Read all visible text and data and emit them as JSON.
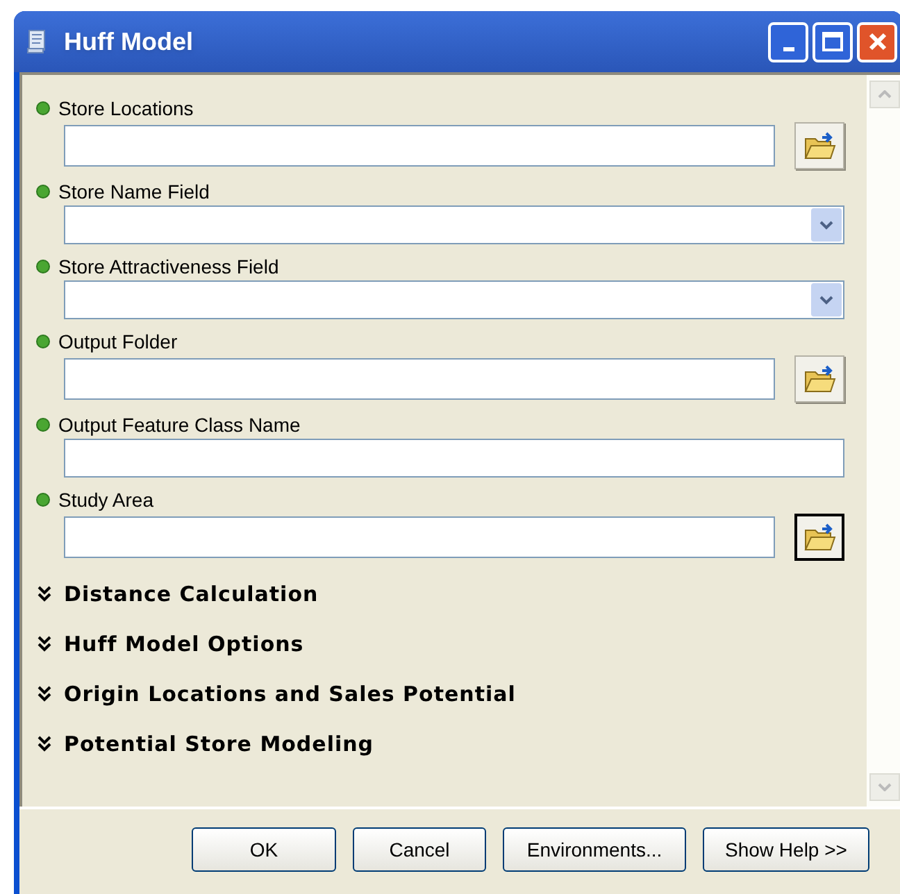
{
  "window": {
    "title": "Huff Model"
  },
  "parameters": [
    {
      "label": "Store Locations",
      "kind": "browse",
      "focused": false
    },
    {
      "label": "Store Name Field",
      "kind": "dropdown"
    },
    {
      "label": "Store Attractiveness Field",
      "kind": "dropdown"
    },
    {
      "label": "Output Folder",
      "kind": "browse",
      "focused": false
    },
    {
      "label": "Output Feature Class Name",
      "kind": "text"
    },
    {
      "label": "Study Area",
      "kind": "browse",
      "focused": true
    }
  ],
  "sections": [
    {
      "label": "Distance Calculation",
      "expanded": false
    },
    {
      "label": "Huff Model Options",
      "expanded": false
    },
    {
      "label": "Origin Locations and Sales Potential",
      "expanded": false
    },
    {
      "label": "Potential Store Modeling",
      "expanded": false
    }
  ],
  "buttons": [
    "OK",
    "Cancel",
    "Environments...",
    "Show Help >>"
  ]
}
